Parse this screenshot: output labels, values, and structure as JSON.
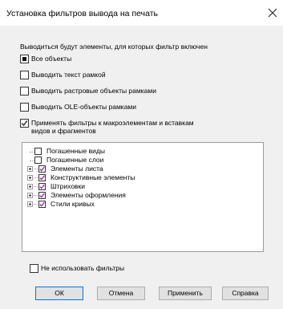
{
  "window": {
    "title": "Установка фильтров вывода на печать"
  },
  "info_text": "Выводиться будут элементы, для которых фильтр включен",
  "options": [
    {
      "label": "Все объекты",
      "state": "indeterminate"
    },
    {
      "label": "Выводить текст рамкой",
      "state": "unchecked"
    },
    {
      "label": "Выводить растровые объекты рамками",
      "state": "unchecked"
    },
    {
      "label": "Выводить OLE-объекты рамками",
      "state": "unchecked"
    },
    {
      "label_line1": "Применять фильтры  к макроэлементам и вставкам",
      "label_line2": "видов и фрагментов",
      "state": "checked"
    }
  ],
  "tree": {
    "items": [
      {
        "label": "Погашенные виды",
        "expandable": false,
        "state": "unchecked"
      },
      {
        "label": "Погашенные слои",
        "expandable": false,
        "state": "unchecked"
      },
      {
        "label": "Элементы листа",
        "expandable": true,
        "state": "checked"
      },
      {
        "label": "Конструктивные элементы",
        "expandable": true,
        "state": "checked"
      },
      {
        "label": "Штриховки",
        "expandable": true,
        "state": "checked"
      },
      {
        "label": "Элементы оформления",
        "expandable": true,
        "state": "checked"
      },
      {
        "label": "Стили кривых",
        "expandable": true,
        "state": "checked"
      }
    ]
  },
  "no_filters": {
    "label": "Не использовать фильтры",
    "state": "unchecked"
  },
  "buttons": {
    "ok": "ОК",
    "cancel": "Отмена",
    "apply": "Применить",
    "help": "Справка"
  },
  "colors": {
    "check_mark": "#9b2ea6",
    "client_bg": "#f0f0f0",
    "default_button_border": "#0078d7"
  }
}
